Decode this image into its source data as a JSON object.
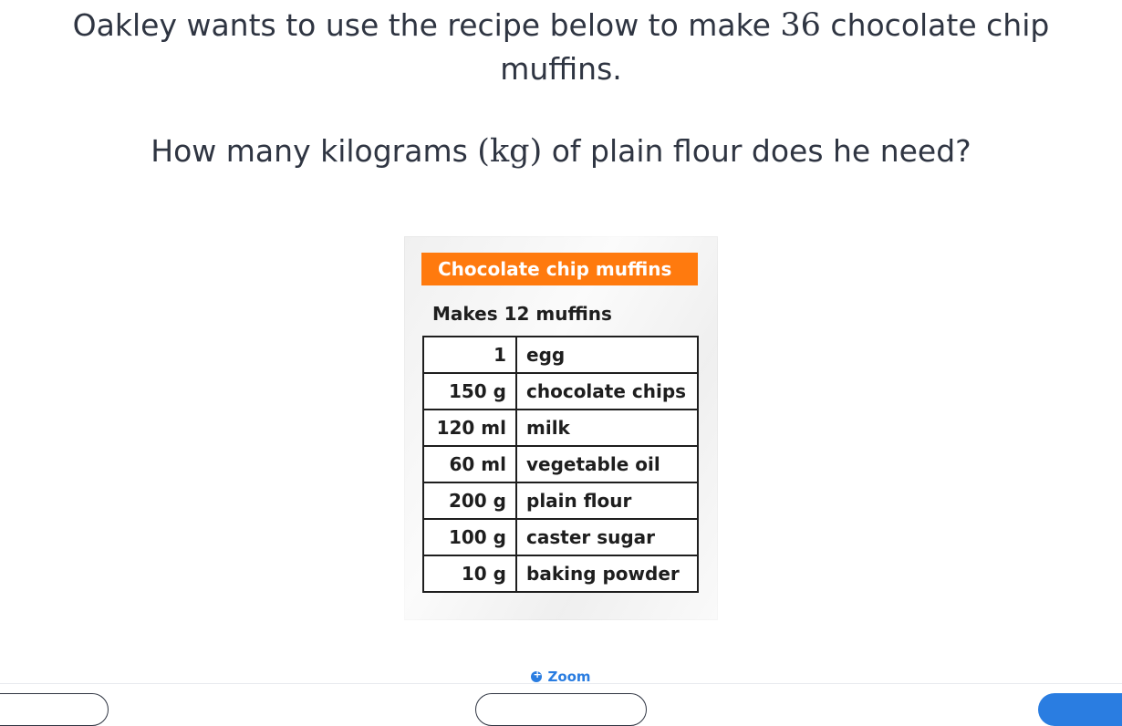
{
  "question": {
    "line1_prefix": "Oakley wants to use the recipe below to make ",
    "line1_number": "36",
    "line1_suffix": " chocolate chip",
    "line1_wrap": "muffins.",
    "line2_prefix": "How many kilograms ",
    "line2_unit": "(kg)",
    "line2_suffix": " of plain flour does he need?"
  },
  "recipe": {
    "title": "Chocolate chip muffins",
    "makes": "Makes 12 muffins",
    "rows": [
      {
        "qty": "1",
        "ingredient": "egg"
      },
      {
        "qty": "150 g",
        "ingredient": "chocolate chips"
      },
      {
        "qty": "120 ml",
        "ingredient": "milk"
      },
      {
        "qty": "60 ml",
        "ingredient": "vegetable oil"
      },
      {
        "qty": "200 g",
        "ingredient": "plain flour"
      },
      {
        "qty": "100 g",
        "ingredient": "caster sugar"
      },
      {
        "qty": "10 g",
        "ingredient": "baking powder"
      }
    ]
  },
  "zoom": {
    "label": "Zoom",
    "icon": "zoom-in-icon"
  },
  "colors": {
    "accent": "#2a7de1",
    "title_bar": "#ff7a0e"
  }
}
